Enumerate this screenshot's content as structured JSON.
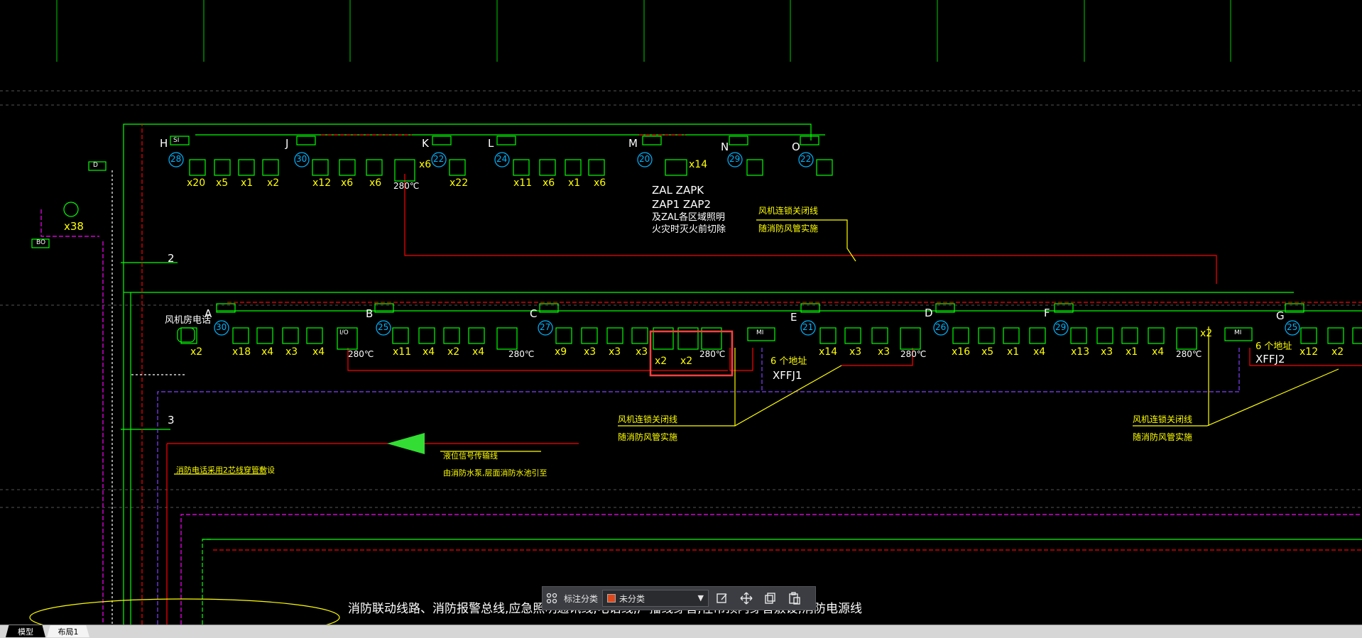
{
  "drawing": {
    "row1_labels": [
      "H",
      "J",
      "K",
      "L",
      "M",
      "N",
      "O"
    ],
    "row1_numbers": [
      "28",
      "30",
      "22",
      "24",
      "20",
      "29",
      "22"
    ],
    "row1_counts": [
      "x20",
      "x5",
      "x1",
      "x2",
      "x12",
      "x6",
      "x6",
      "x6",
      "x22",
      "x11",
      "x6",
      "x1",
      "x6",
      "x14"
    ],
    "row1_temp": "280℃",
    "zal_block": [
      "ZAL  ZAPK",
      "ZAP1  ZAP2",
      "及ZAL各区域照明",
      "火灾时灭火前切除"
    ],
    "fan_note1": [
      "风机连锁关闭线",
      "随消防风管实施"
    ],
    "left_labels": {
      "d": "D",
      "bo": "BO",
      "x38": "x38",
      "num2": "2",
      "num3": "3",
      "phone": "风机房电话",
      "x2": "x2"
    },
    "row2_labels": [
      "A",
      "B",
      "C",
      "E",
      "D",
      "F",
      "G"
    ],
    "row2_numbers": [
      "30",
      "25",
      "27",
      "21",
      "26",
      "29",
      "25"
    ],
    "row2_counts": [
      "x18",
      "x4",
      "x3",
      "x4",
      "x11",
      "x4",
      "x2",
      "x4",
      "x9",
      "x3",
      "x3",
      "x3",
      "x2",
      "x2",
      "x14",
      "x3",
      "x3",
      "x16",
      "x5",
      "x1",
      "x4",
      "x13",
      "x3",
      "x1",
      "x4",
      "x2",
      "x12",
      "x2"
    ],
    "row2_temp": "280℃",
    "si_label": "SI",
    "io_label": "I/O",
    "mi_label": "MI",
    "addr1": [
      "6 个地址",
      "XFFJ1"
    ],
    "addr2": [
      "6 个地址",
      "XFFJ2"
    ],
    "fan_note2": [
      "风机连锁关闭线",
      "随消防风管实施"
    ],
    "fan_note3": [
      "风机连锁关闭线",
      "随消防风管实施"
    ],
    "phone_note": "消防电话采用2芯线穿管敷设",
    "signal_note": [
      "液位信号传输线",
      "由消防水泵,层面消防水池引至"
    ],
    "bottom_text": "消防联动线路、消防报警总线,应急照明通讯线,电话线,广播线穿管,在吊顶内穿管敷设,消防电源线"
  },
  "annotation_bar": {
    "label": "标注分类",
    "selected": "未分类",
    "swatch_color": "#e0481b"
  },
  "tabs": {
    "model": "模型",
    "layout": "布局1"
  },
  "colors": {
    "green": "#00ff00",
    "red": "#ff0000",
    "yellow": "#ffff00",
    "purple": "#8040ff",
    "magenta": "#ff00ff",
    "white": "#ffffff",
    "cyan": "#00b4ff",
    "highlight": "#ff4040"
  }
}
